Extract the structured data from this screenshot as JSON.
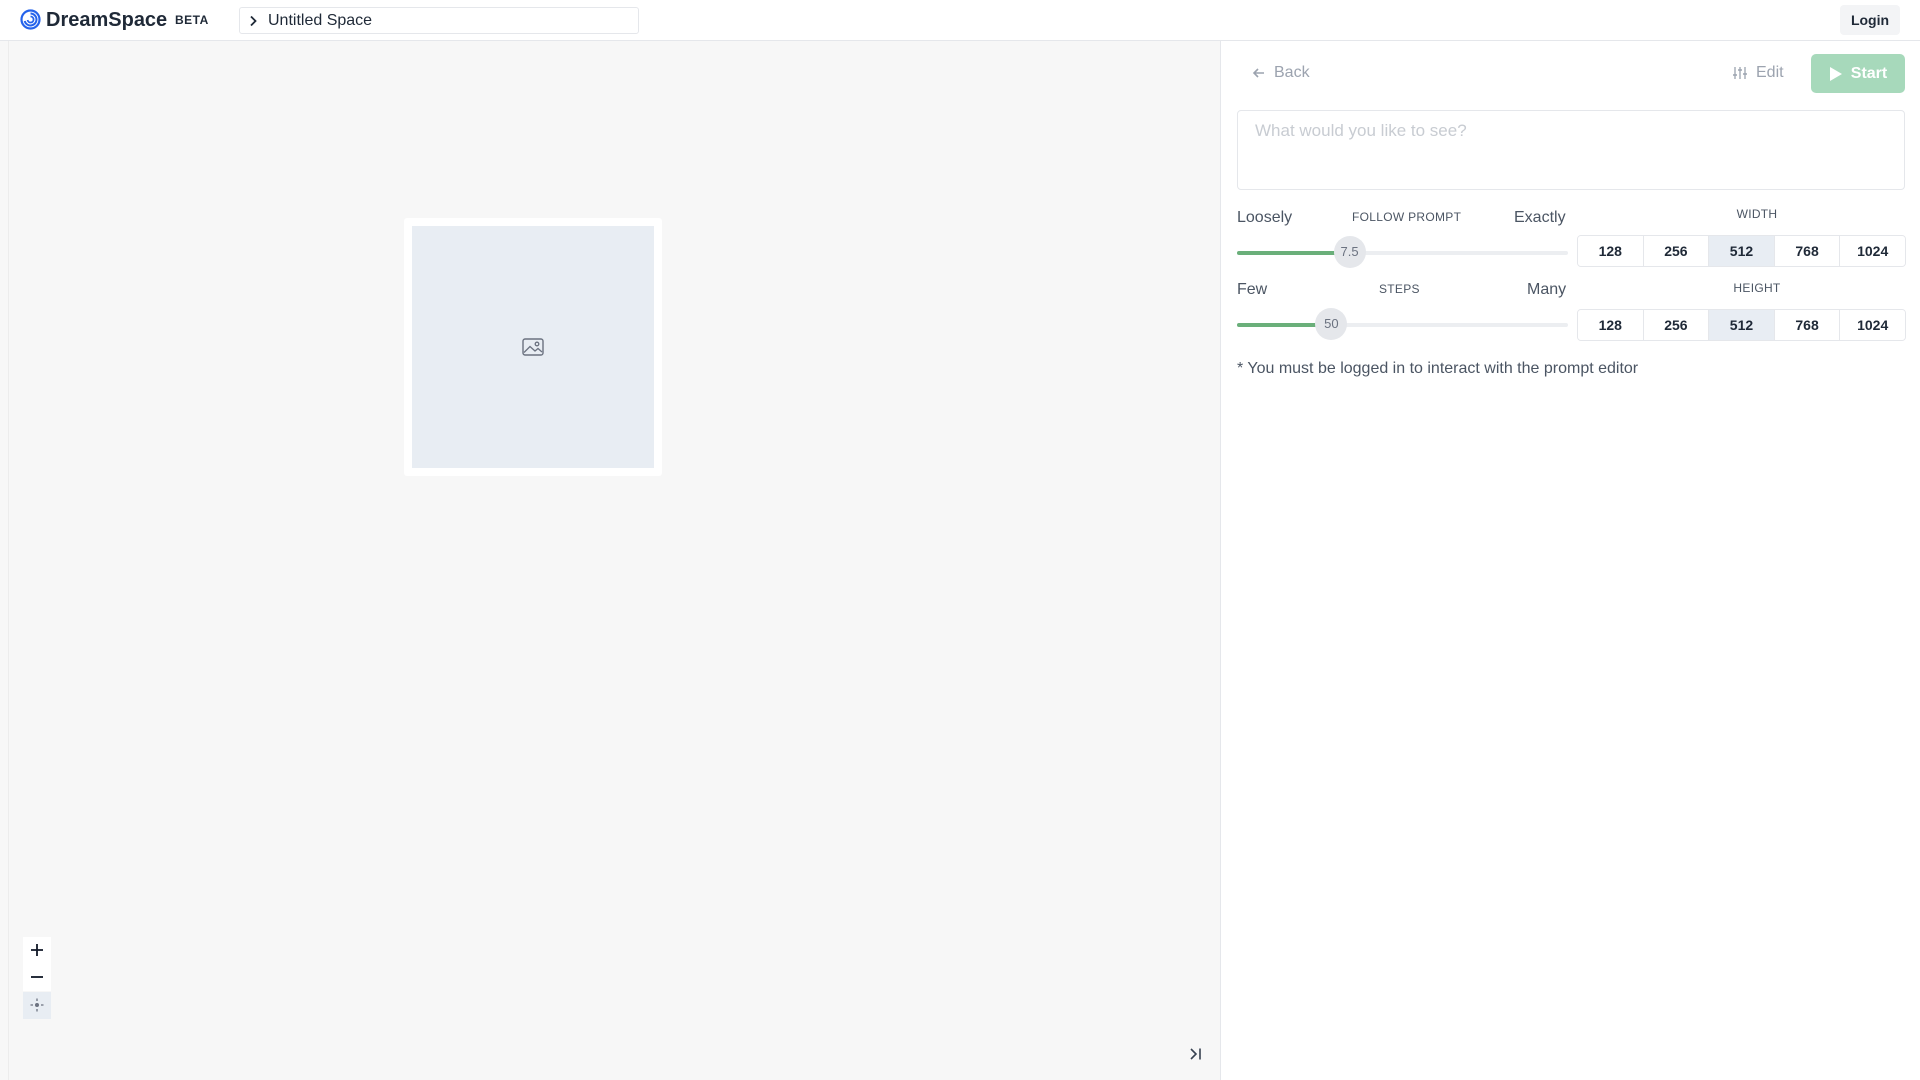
{
  "header": {
    "brand": "DreamSpace",
    "badge": "BETA",
    "space_name": "Untitled Space",
    "login_label": "Login",
    "icons": [
      "dreamspace-logo-icon",
      "chevron-right-icon"
    ]
  },
  "canvas": {
    "icons": [
      "image-placeholder-icon",
      "plus-icon",
      "minus-icon",
      "recenter-icon",
      "collapse-panel-icon"
    ]
  },
  "panel": {
    "back_label": "Back",
    "edit_label": "Edit",
    "start_label": "Start",
    "prompt_placeholder": "What would you like to see?",
    "follow_prompt": {
      "title": "FOLLOW PROMPT",
      "min_label": "Loosely",
      "max_label": "Exactly",
      "value": "7.5",
      "fill_fraction": 0.34
    },
    "steps": {
      "title": "STEPS",
      "min_label": "Few",
      "max_label": "Many",
      "value": "50",
      "fill_fraction": 0.285
    },
    "width": {
      "title": "WIDTH",
      "options": [
        "128",
        "256",
        "512",
        "768",
        "1024"
      ],
      "selected": "512"
    },
    "height": {
      "title": "HEIGHT",
      "options": [
        "128",
        "256",
        "512",
        "768",
        "1024"
      ],
      "selected": "512"
    },
    "login_note": "* You must be logged in to interact with the prompt editor",
    "accent_color": "#6aaf7a",
    "start_color": "#a7d9bb"
  }
}
